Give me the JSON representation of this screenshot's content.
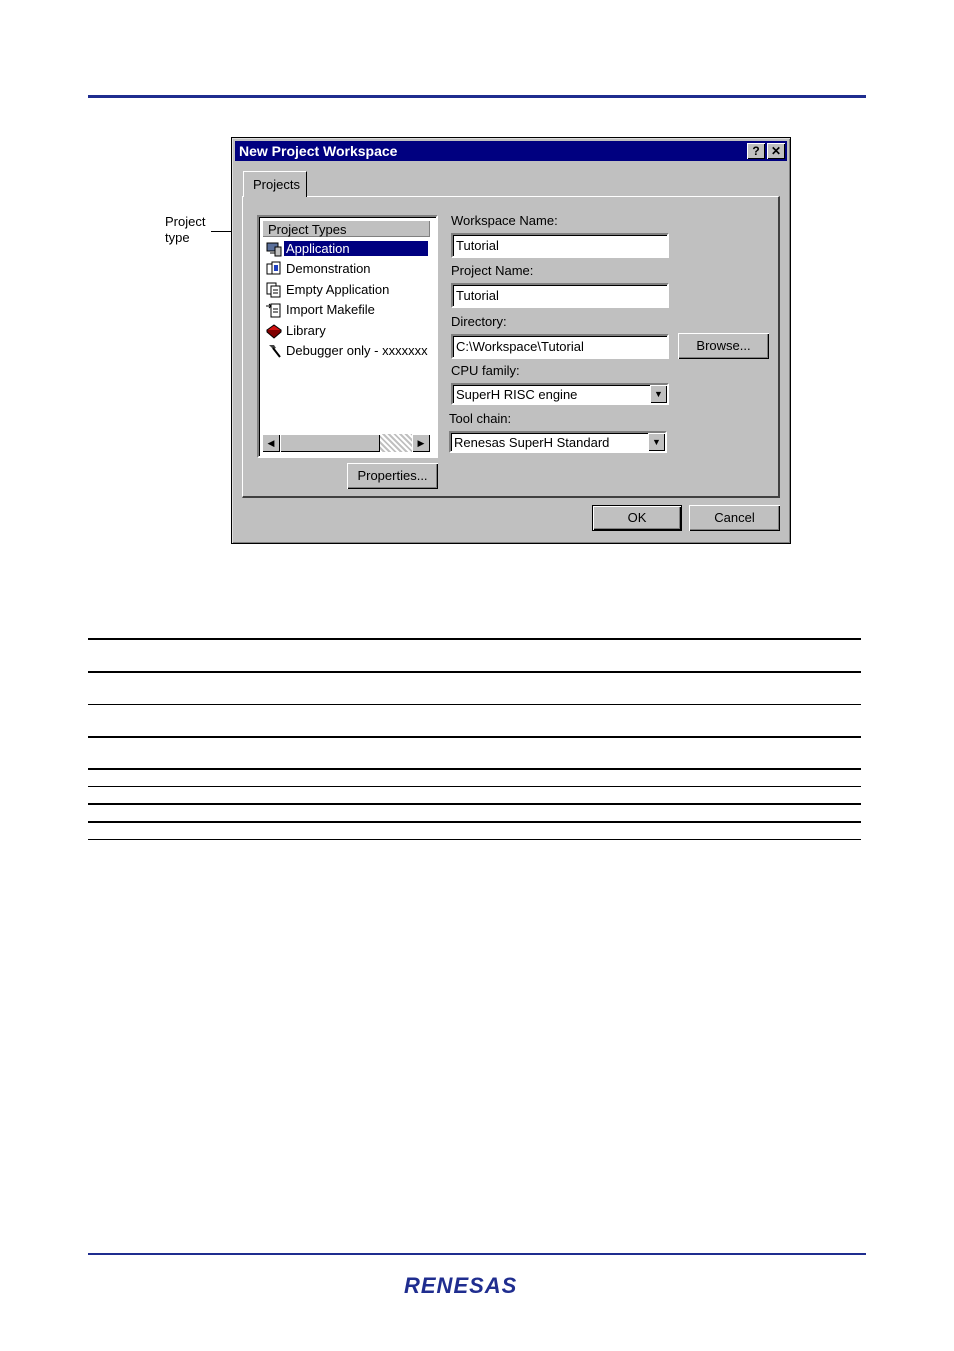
{
  "annotation": {
    "line1": "Project",
    "line2": "type"
  },
  "dialog": {
    "title": "New Project Workspace",
    "help_button": "?",
    "close_button": "✕",
    "tab": "Projects",
    "project_types_header": "Project Types",
    "project_types": [
      {
        "label": "Application",
        "icon": "application-icon",
        "selected": true
      },
      {
        "label": "Demonstration",
        "icon": "demonstration-icon",
        "selected": false
      },
      {
        "label": "Empty Application",
        "icon": "empty-application-icon",
        "selected": false
      },
      {
        "label": "Import Makefile",
        "icon": "import-makefile-icon",
        "selected": false
      },
      {
        "label": "Library",
        "icon": "library-book-icon",
        "selected": false
      },
      {
        "label": "Debugger only - xxxxxxx",
        "icon": "hammer-icon",
        "selected": false
      }
    ],
    "properties_button": "Properties...",
    "workspace_name_label": "Workspace Name:",
    "workspace_name_value": "Tutorial",
    "project_name_label": "Project Name:",
    "project_name_value": "Tutorial",
    "directory_label": "Directory:",
    "directory_value": "C:\\Workspace\\Tutorial",
    "browse_button": "Browse...",
    "cpu_family_label": "CPU family:",
    "cpu_family_value": "SuperH RISC engine",
    "tool_chain_label": "Tool chain:",
    "tool_chain_value": "Renesas SuperH Standard",
    "ok_button": "OK",
    "cancel_button": "Cancel"
  },
  "footer": {
    "logo_text": "RENESAS",
    "brand_color": "#1f2d8f"
  }
}
